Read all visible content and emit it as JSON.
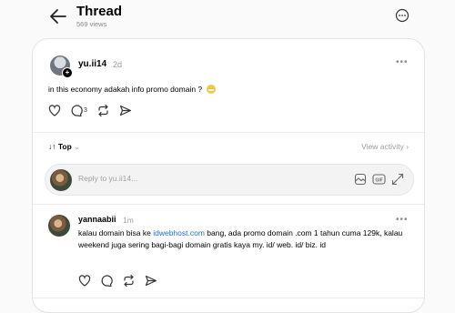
{
  "header": {
    "title": "Thread",
    "views": "569 views"
  },
  "post": {
    "username": "yu.ii14",
    "time": "2d",
    "text": "in this economy adakah info promo domain ?",
    "reply_count": "3"
  },
  "sort": {
    "label": "Top",
    "view_activity": "View activity"
  },
  "reply_box": {
    "placeholder": "Reply to yu.ii14..."
  },
  "reply": {
    "username": "yannaabii",
    "time": "1m",
    "text_before": "kalau domain bisa ke ",
    "link": "idwebhost.com",
    "text_after": " bang, ada promo domain .com 1 tahun cuma 129k, kalau weekend juga sering bagi-bagi domain gratis kaya my. id/ web. id/ biz. id"
  },
  "icons": {
    "back": "arrow-left-icon",
    "more": "more-circle-icon",
    "like": "heart-icon",
    "comment": "comment-icon",
    "repost": "repost-icon",
    "share": "send-icon",
    "gif": "gif-icon",
    "image": "image-icon",
    "expand": "expand-icon"
  }
}
